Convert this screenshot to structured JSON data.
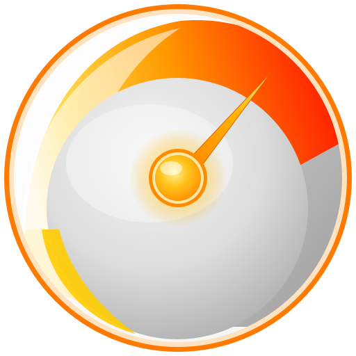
{
  "icon": {
    "name": "speedometer-gauge-icon",
    "needle_level": 0.82
  },
  "colors": {
    "rim_orange": "#ff7a00",
    "arc_red": "#ff1e00",
    "arc_yellow": "#ffd000",
    "dial_light": "#f2f2f2",
    "dial_shadow": "#bdbdbd",
    "hub_amber": "#ffa500"
  }
}
